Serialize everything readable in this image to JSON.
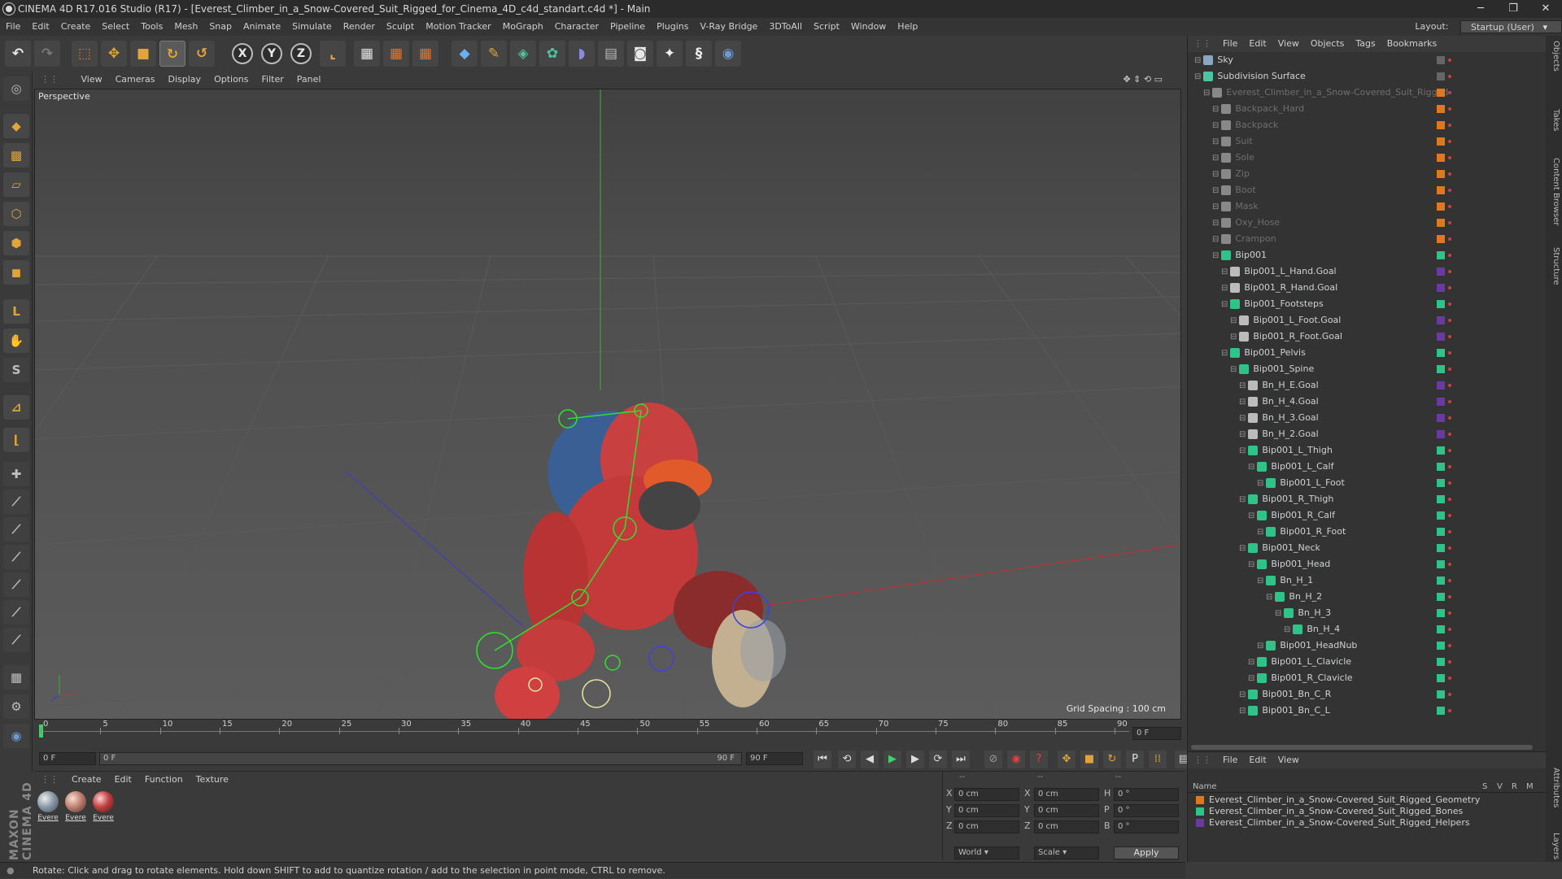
{
  "window": {
    "title": "CINEMA 4D R17.016 Studio (R17) - [Everest_Climber_in_a_Snow-Covered_Suit_Rigged_for_Cinema_4D_c4d_standart.c4d *] - Main",
    "minimize": "─",
    "maximize": "❐",
    "close": "✕"
  },
  "menubar": {
    "items": [
      "File",
      "Edit",
      "Create",
      "Select",
      "Tools",
      "Mesh",
      "Snap",
      "Animate",
      "Simulate",
      "Render",
      "Sculpt",
      "Motion Tracker",
      "MoGraph",
      "Character",
      "Pipeline",
      "Plugins",
      "V-Ray Bridge",
      "3DToAll",
      "Script",
      "Window",
      "Help"
    ],
    "layout_label": "Layout:",
    "layout_value": "Startup (User)"
  },
  "viewport": {
    "menu": [
      "View",
      "Cameras",
      "Display",
      "Options",
      "Filter",
      "Panel"
    ],
    "camera_label": "Perspective",
    "grid_spacing": "Grid Spacing : 100 cm"
  },
  "timeline": {
    "ticks": [
      "0",
      "5",
      "10",
      "15",
      "20",
      "25",
      "30",
      "35",
      "40",
      "45",
      "50",
      "55",
      "60",
      "65",
      "70",
      "75",
      "80",
      "85",
      "90"
    ],
    "current_frame_display": "0 F",
    "start_field": "0 F",
    "range_start": "0 F",
    "range_end": "90 F",
    "end_field": "90 F"
  },
  "materials": {
    "menu": [
      "Create",
      "Edit",
      "Function",
      "Texture"
    ],
    "items": [
      "Evere",
      "Evere",
      "Evere"
    ]
  },
  "coordinates": {
    "header": [
      "--",
      "--",
      "--"
    ],
    "rows": [
      {
        "axis": "X",
        "pos": "0 cm",
        "axis2": "X",
        "size": "0 cm",
        "rot_axis": "H",
        "rot": "0 °"
      },
      {
        "axis": "Y",
        "pos": "0 cm",
        "axis2": "Y",
        "size": "0 cm",
        "rot_axis": "P",
        "rot": "0 °"
      },
      {
        "axis": "Z",
        "pos": "0 cm",
        "axis2": "Z",
        "size": "0 cm",
        "rot_axis": "B",
        "rot": "0 °"
      }
    ],
    "mode_world": "World",
    "mode_scale": "Scale",
    "apply": "Apply"
  },
  "object_manager": {
    "menu": [
      "File",
      "Edit",
      "View",
      "Objects",
      "Tags",
      "Bookmarks"
    ],
    "objects": [
      {
        "name": "Sky",
        "indent": 0,
        "dim": false,
        "layer": "",
        "icon": "#8aa6c0"
      },
      {
        "name": "Subdivision Surface",
        "indent": 0,
        "dim": false,
        "layer": "",
        "icon": "#4fc4a0"
      },
      {
        "name": "Everest_Climber_in_a_Snow-Covered_Suit_Rigged",
        "indent": 1,
        "dim": true,
        "layer": "#e07820",
        "icon": "#888"
      },
      {
        "name": "Backpack_Hard",
        "indent": 2,
        "dim": true,
        "layer": "#e07820",
        "icon": "#888"
      },
      {
        "name": "Backpack",
        "indent": 2,
        "dim": true,
        "layer": "#e07820",
        "icon": "#888"
      },
      {
        "name": "Suit",
        "indent": 2,
        "dim": true,
        "layer": "#e07820",
        "icon": "#888"
      },
      {
        "name": "Sole",
        "indent": 2,
        "dim": true,
        "layer": "#e07820",
        "icon": "#888"
      },
      {
        "name": "Zip",
        "indent": 2,
        "dim": true,
        "layer": "#e07820",
        "icon": "#888"
      },
      {
        "name": "Boot",
        "indent": 2,
        "dim": true,
        "layer": "#e07820",
        "icon": "#888"
      },
      {
        "name": "Mask",
        "indent": 2,
        "dim": true,
        "layer": "#e07820",
        "icon": "#888"
      },
      {
        "name": "Oxy_Hose",
        "indent": 2,
        "dim": true,
        "layer": "#e07820",
        "icon": "#888"
      },
      {
        "name": "Crampon",
        "indent": 2,
        "dim": true,
        "layer": "#e07820",
        "icon": "#888"
      },
      {
        "name": "Bip001",
        "indent": 2,
        "dim": false,
        "layer": "#2fc38a",
        "icon": "#2fc38a"
      },
      {
        "name": "Bip001_L_Hand.Goal",
        "indent": 3,
        "dim": false,
        "layer": "#6a3aa0",
        "icon": "#bbb"
      },
      {
        "name": "Bip001_R_Hand.Goal",
        "indent": 3,
        "dim": false,
        "layer": "#6a3aa0",
        "icon": "#bbb"
      },
      {
        "name": "Bip001_Footsteps",
        "indent": 3,
        "dim": false,
        "layer": "#2fc38a",
        "icon": "#2fc38a"
      },
      {
        "name": "Bip001_L_Foot.Goal",
        "indent": 4,
        "dim": false,
        "layer": "#6a3aa0",
        "icon": "#bbb"
      },
      {
        "name": "Bip001_R_Foot.Goal",
        "indent": 4,
        "dim": false,
        "layer": "#6a3aa0",
        "icon": "#bbb"
      },
      {
        "name": "Bip001_Pelvis",
        "indent": 3,
        "dim": false,
        "layer": "#2fc38a",
        "icon": "#2fc38a"
      },
      {
        "name": "Bip001_Spine",
        "indent": 4,
        "dim": false,
        "layer": "#2fc38a",
        "icon": "#2fc38a"
      },
      {
        "name": "Bn_H_E.Goal",
        "indent": 5,
        "dim": false,
        "layer": "#6a3aa0",
        "icon": "#bbb"
      },
      {
        "name": "Bn_H_4.Goal",
        "indent": 5,
        "dim": false,
        "layer": "#6a3aa0",
        "icon": "#bbb"
      },
      {
        "name": "Bn_H_3.Goal",
        "indent": 5,
        "dim": false,
        "layer": "#6a3aa0",
        "icon": "#bbb"
      },
      {
        "name": "Bn_H_2.Goal",
        "indent": 5,
        "dim": false,
        "layer": "#6a3aa0",
        "icon": "#bbb"
      },
      {
        "name": "Bip001_L_Thigh",
        "indent": 5,
        "dim": false,
        "layer": "#2fc38a",
        "icon": "#2fc38a"
      },
      {
        "name": "Bip001_L_Calf",
        "indent": 6,
        "dim": false,
        "layer": "#2fc38a",
        "icon": "#2fc38a"
      },
      {
        "name": "Bip001_L_Foot",
        "indent": 7,
        "dim": false,
        "layer": "#2fc38a",
        "icon": "#2fc38a"
      },
      {
        "name": "Bip001_R_Thigh",
        "indent": 5,
        "dim": false,
        "layer": "#2fc38a",
        "icon": "#2fc38a"
      },
      {
        "name": "Bip001_R_Calf",
        "indent": 6,
        "dim": false,
        "layer": "#2fc38a",
        "icon": "#2fc38a"
      },
      {
        "name": "Bip001_R_Foot",
        "indent": 7,
        "dim": false,
        "layer": "#2fc38a",
        "icon": "#2fc38a"
      },
      {
        "name": "Bip001_Neck",
        "indent": 5,
        "dim": false,
        "layer": "#2fc38a",
        "icon": "#2fc38a"
      },
      {
        "name": "Bip001_Head",
        "indent": 6,
        "dim": false,
        "layer": "#2fc38a",
        "icon": "#2fc38a"
      },
      {
        "name": "Bn_H_1",
        "indent": 7,
        "dim": false,
        "layer": "#2fc38a",
        "icon": "#2fc38a"
      },
      {
        "name": "Bn_H_2",
        "indent": 8,
        "dim": false,
        "layer": "#2fc38a",
        "icon": "#2fc38a"
      },
      {
        "name": "Bn_H_3",
        "indent": 9,
        "dim": false,
        "layer": "#2fc38a",
        "icon": "#2fc38a"
      },
      {
        "name": "Bn_H_4",
        "indent": 10,
        "dim": false,
        "layer": "#2fc38a",
        "icon": "#2fc38a"
      },
      {
        "name": "Bip001_HeadNub",
        "indent": 7,
        "dim": false,
        "layer": "#2fc38a",
        "icon": "#2fc38a"
      },
      {
        "name": "Bip001_L_Clavicle",
        "indent": 6,
        "dim": false,
        "layer": "#2fc38a",
        "icon": "#2fc38a"
      },
      {
        "name": "Bip001_R_Clavicle",
        "indent": 6,
        "dim": false,
        "layer": "#2fc38a",
        "icon": "#2fc38a"
      },
      {
        "name": "Bip001_Bn_C_R",
        "indent": 5,
        "dim": false,
        "layer": "#2fc38a",
        "icon": "#2fc38a"
      },
      {
        "name": "Bip001_Bn_C_L",
        "indent": 5,
        "dim": false,
        "layer": "#2fc38a",
        "icon": "#2fc38a"
      }
    ]
  },
  "layer_manager": {
    "menu": [
      "File",
      "Edit",
      "View"
    ],
    "columns": {
      "name": "Name",
      "s": "S",
      "v": "V",
      "r": "R",
      "m": "M"
    },
    "layers": [
      {
        "name": "Everest_Climber_in_a_Snow-Covered_Suit_Rigged_Geometry",
        "color": "#e07820"
      },
      {
        "name": "Everest_Climber_in_a_Snow-Covered_Suit_Rigged_Bones",
        "color": "#2fc38a"
      },
      {
        "name": "Everest_Climber_in_a_Snow-Covered_Suit_Rigged_Helpers",
        "color": "#6a3aa0"
      }
    ]
  },
  "side_tabs": [
    "Objects",
    "Takes",
    "Content Browser",
    "Structure",
    "Attributes",
    "Layers"
  ],
  "branding": "MAXON CINEMA 4D",
  "status": "Rotate: Click and drag to rotate elements. Hold down SHIFT to add to quantize rotation / add to the selection in point mode, CTRL to remove."
}
